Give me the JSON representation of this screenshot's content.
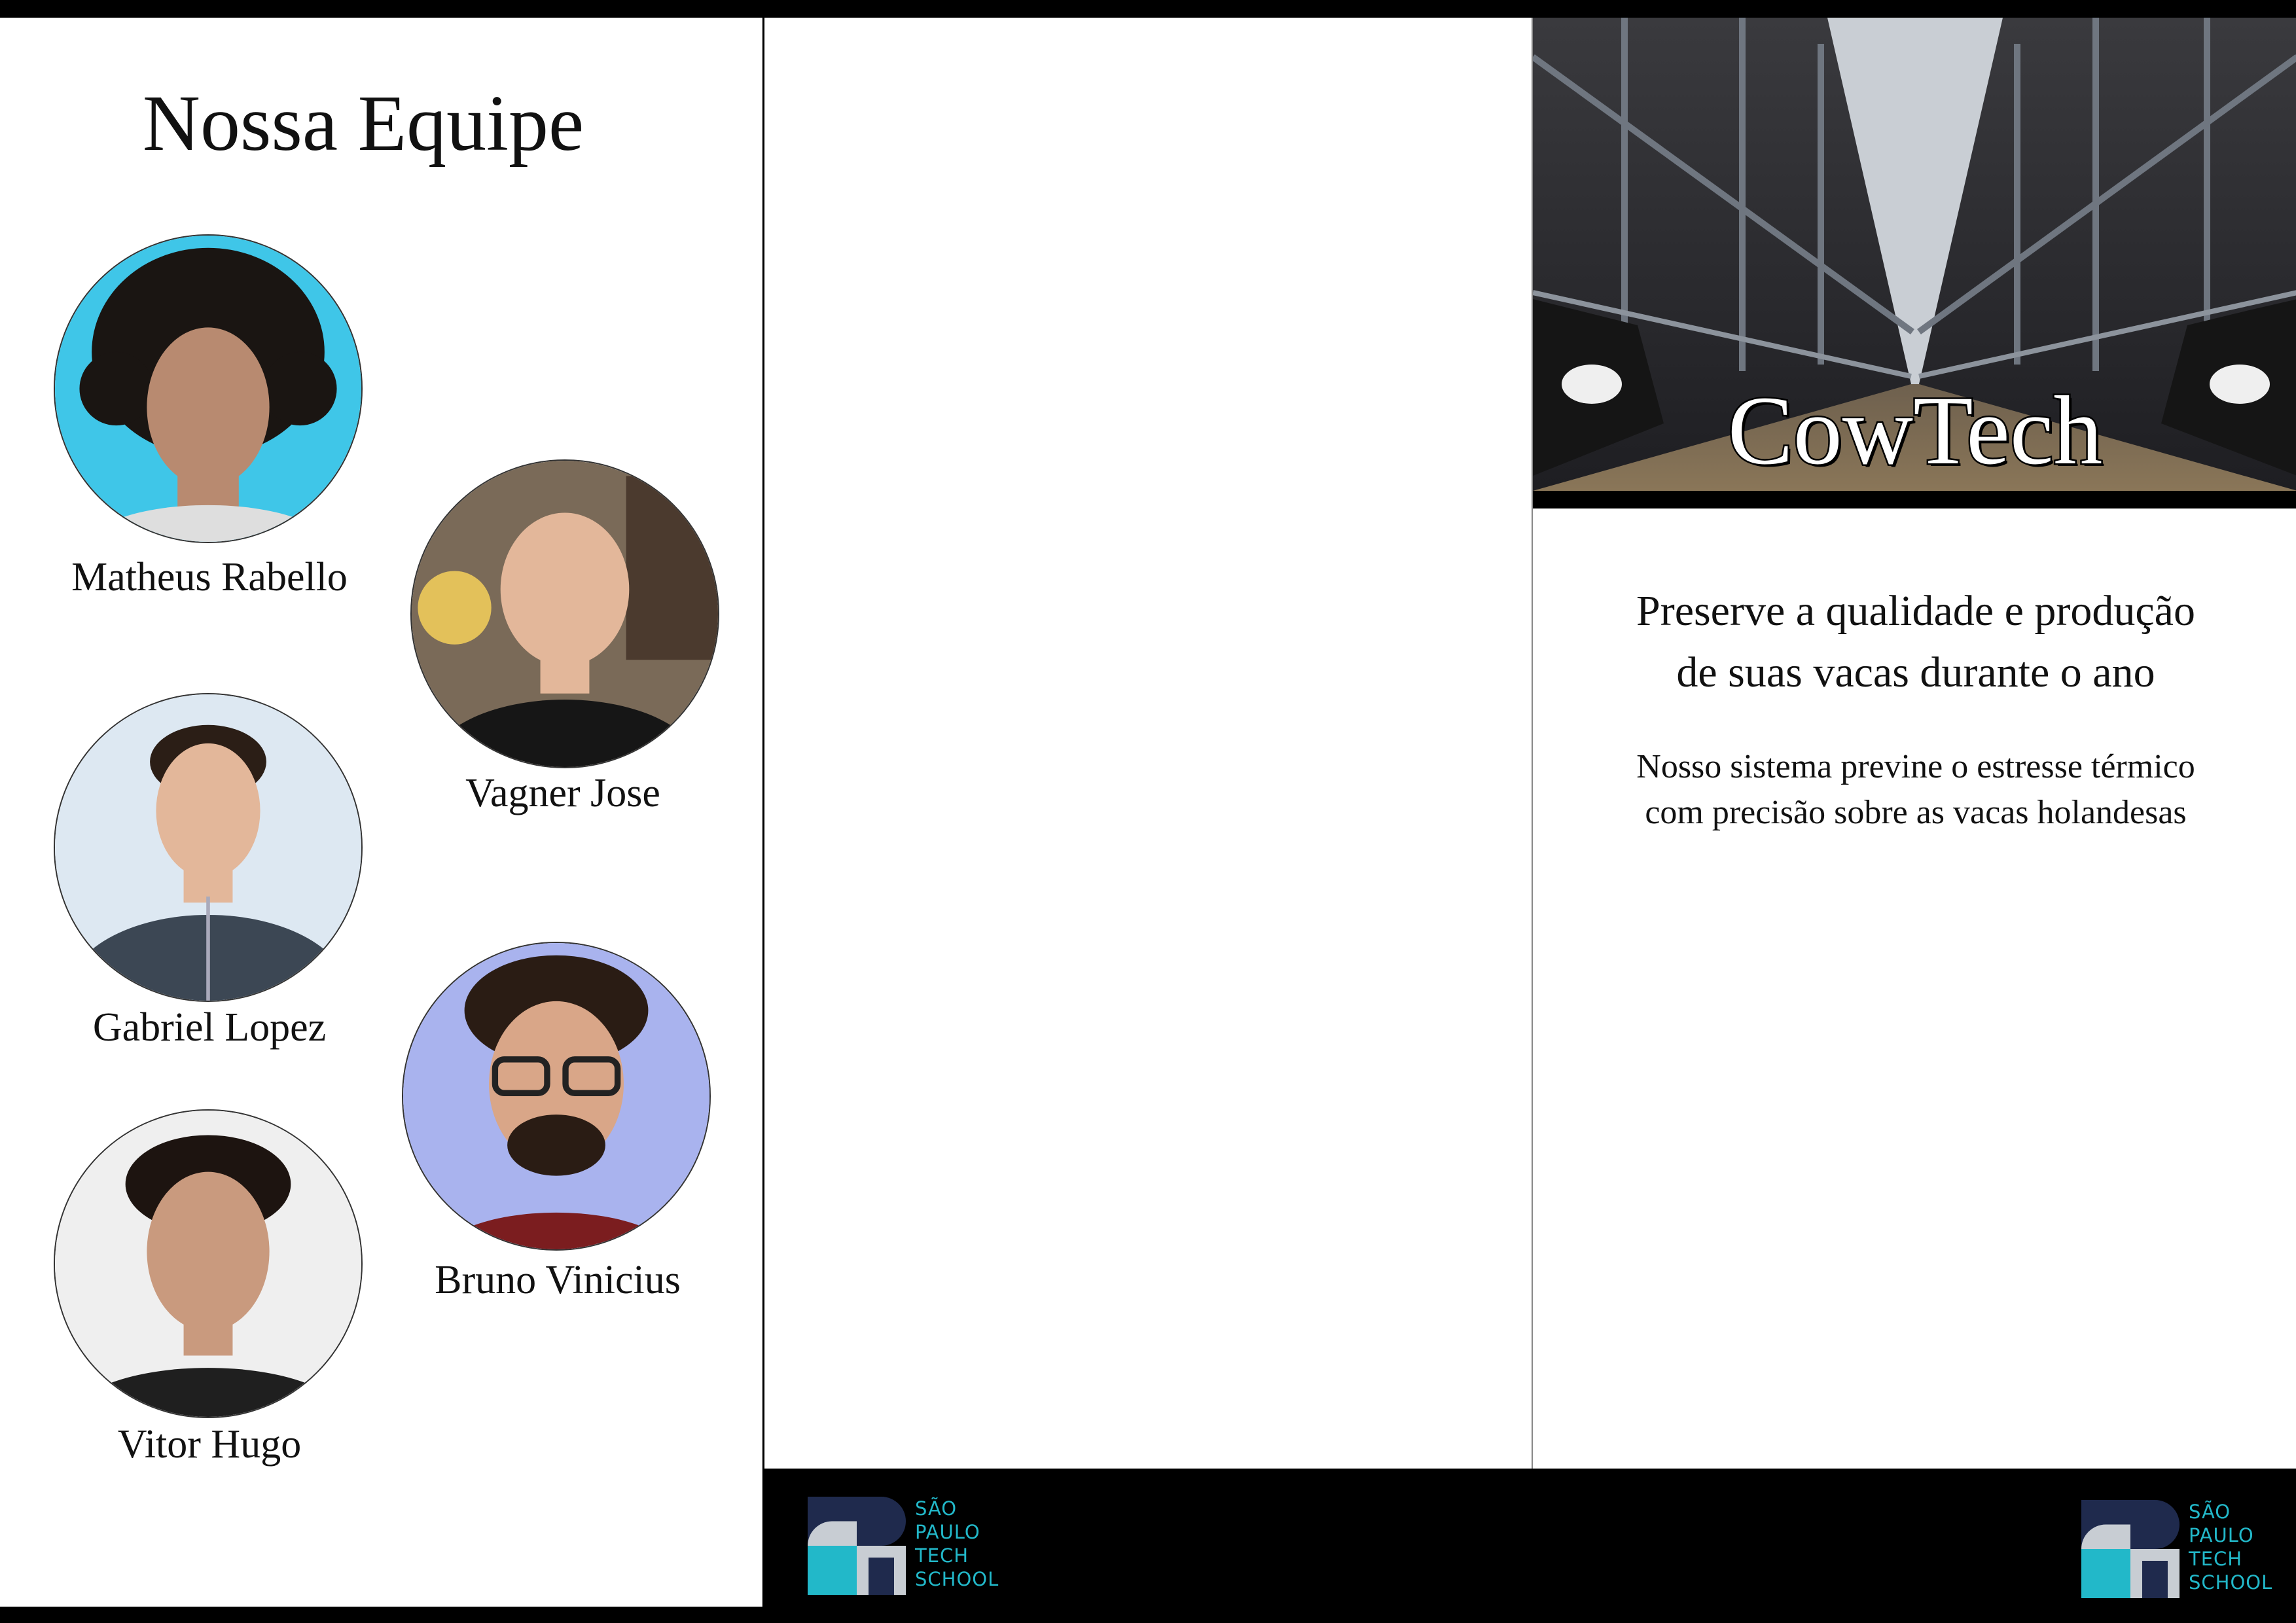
{
  "team": {
    "title": "Nossa Equipe",
    "members": [
      {
        "name": "Matheus Rabello",
        "photo_bg": "#3fc6e8"
      },
      {
        "name": "Vagner Jose",
        "photo_bg": "#7a6a58"
      },
      {
        "name": "Gabriel Lopez",
        "photo_bg": "#dde8f2"
      },
      {
        "name": "Bruno Vinicius",
        "photo_bg": "#a9b3ee"
      },
      {
        "name": "Vitor Hugo",
        "photo_bg": "#efefef"
      }
    ]
  },
  "cover": {
    "brand": "CowTech",
    "headline_line1": "Preserve a qualidade e produção",
    "headline_line2": "de suas vacas durante o ano",
    "subtext_line1": "Nosso sistema previne o estresse térmico",
    "subtext_line2": "com precisão sobre as vacas holandesas"
  },
  "logo": {
    "line1": "SÃO",
    "line2": "PAULO",
    "line3": "TECH",
    "line4": "SCHOOL",
    "colors": {
      "navy": "#1f2a4d",
      "grey": "#c8cdd3",
      "teal": "#22b8c9"
    }
  }
}
